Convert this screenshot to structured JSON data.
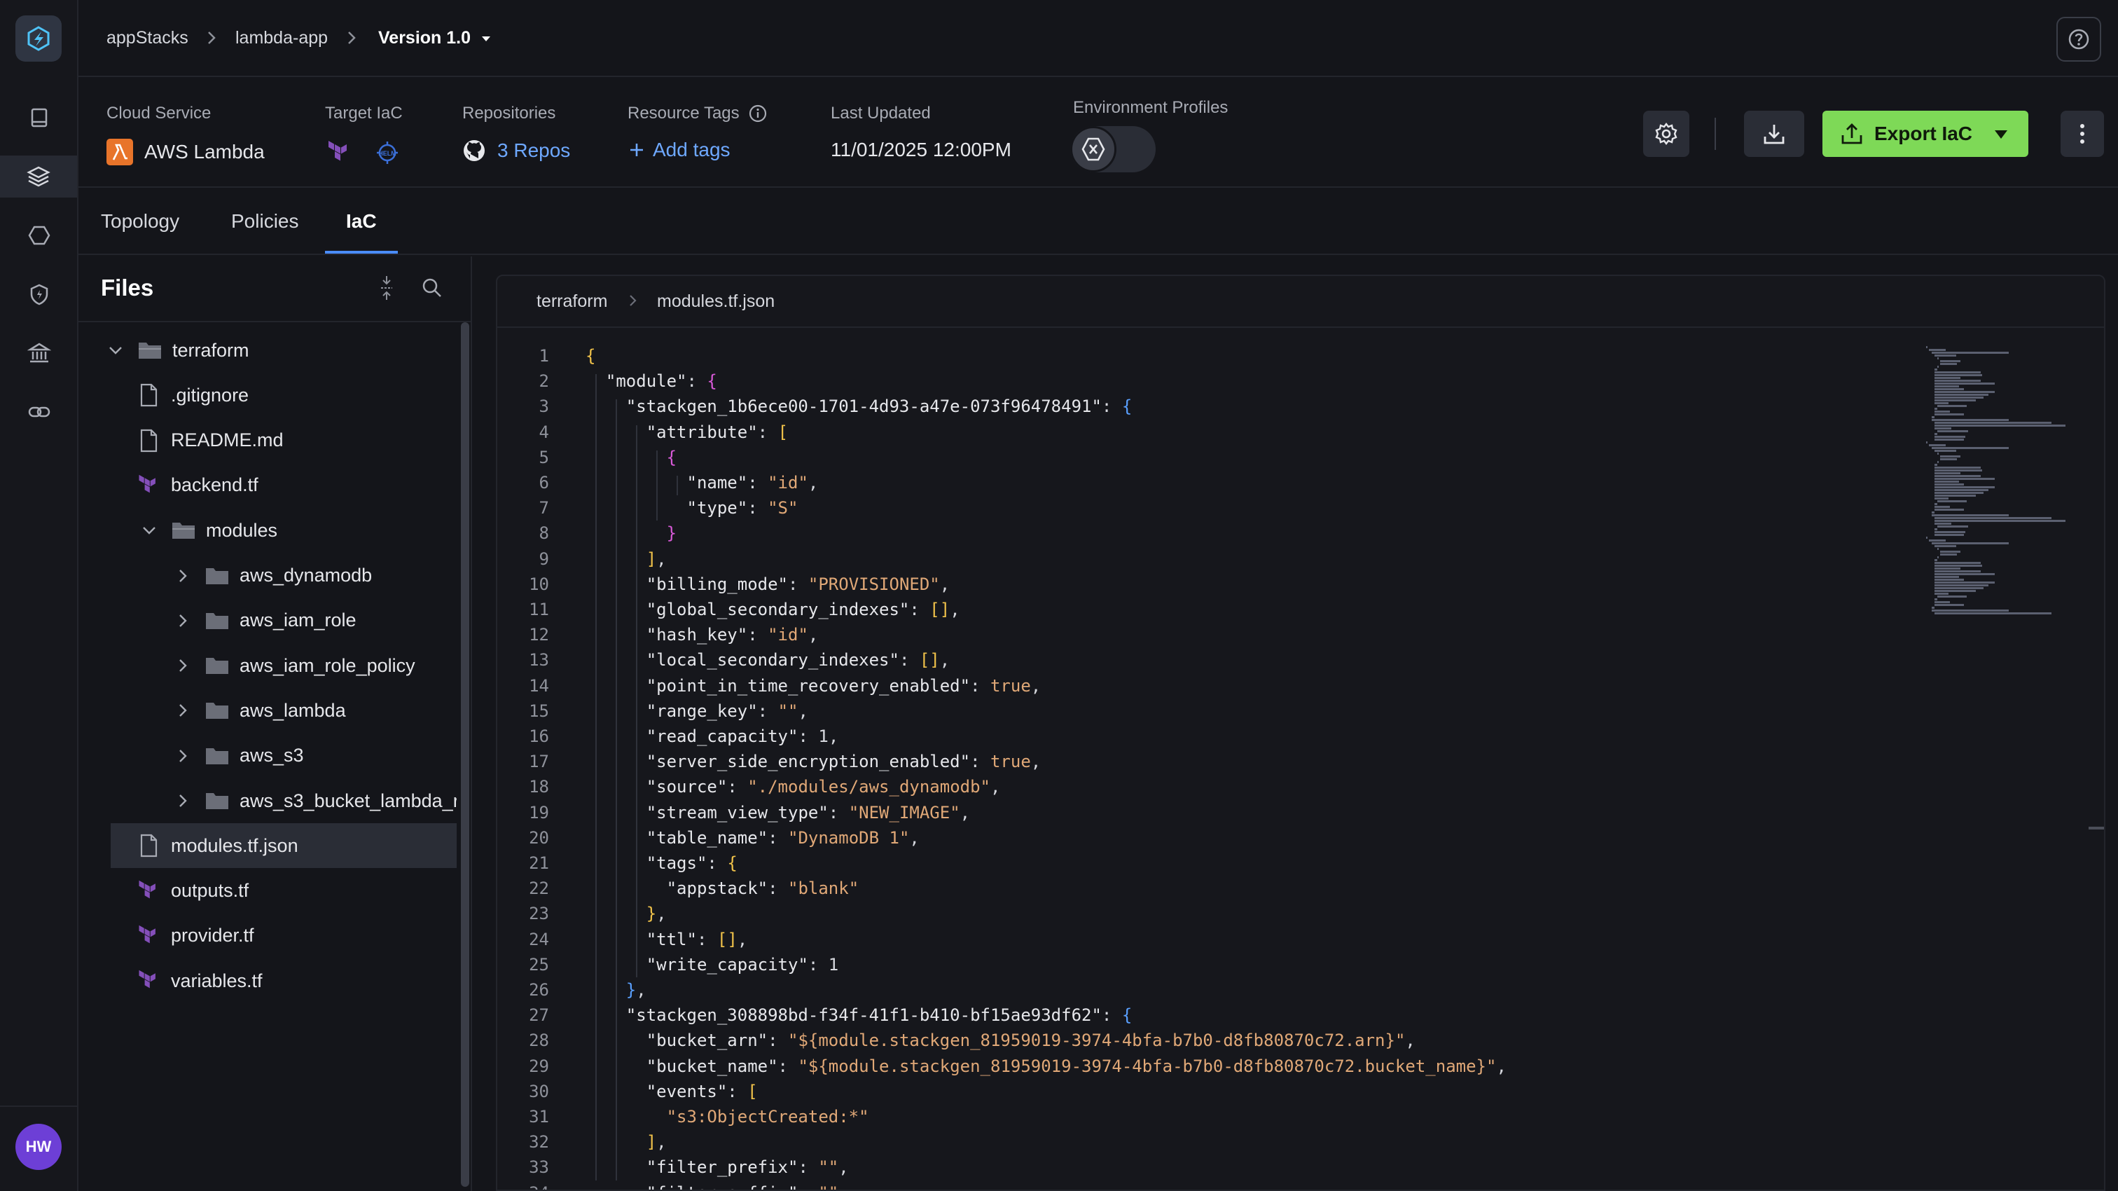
{
  "rail": {
    "avatar_initials": "HW"
  },
  "breadcrumb": {
    "items": [
      "appStacks",
      "lambda-app"
    ],
    "version": "Version 1.0"
  },
  "info": {
    "cloud_service_label": "Cloud Service",
    "cloud_service_value": "AWS Lambda",
    "target_iac_label": "Target IaC",
    "repositories_label": "Repositories",
    "repositories_value": "3 Repos",
    "resource_tags_label": "Resource Tags",
    "add_tags_label": "Add tags",
    "last_updated_label": "Last Updated",
    "last_updated_value": "11/01/2025 12:00PM",
    "env_profiles_label": "Environment Profiles",
    "export_label": "Export IaC"
  },
  "tabs": [
    "Topology",
    "Policies",
    "IaC"
  ],
  "files": {
    "title": "Files",
    "tree": [
      {
        "label": "terraform",
        "type": "folder-open",
        "depth": 0,
        "chev": "down"
      },
      {
        "label": ".gitignore",
        "type": "file",
        "depth": 1
      },
      {
        "label": "README.md",
        "type": "file",
        "depth": 1
      },
      {
        "label": "backend.tf",
        "type": "tf",
        "depth": 1
      },
      {
        "label": "modules",
        "type": "folder-open",
        "depth": 1,
        "chev": "down"
      },
      {
        "label": "aws_dynamodb",
        "type": "folder",
        "depth": 2,
        "chev": "right"
      },
      {
        "label": "aws_iam_role",
        "type": "folder",
        "depth": 2,
        "chev": "right"
      },
      {
        "label": "aws_iam_role_policy",
        "type": "folder",
        "depth": 2,
        "chev": "right"
      },
      {
        "label": "aws_lambda",
        "type": "folder",
        "depth": 2,
        "chev": "right"
      },
      {
        "label": "aws_s3",
        "type": "folder",
        "depth": 2,
        "chev": "right"
      },
      {
        "label": "aws_s3_bucket_lambda_r",
        "type": "folder",
        "depth": 2,
        "chev": "right"
      },
      {
        "label": "modules.tf.json",
        "type": "file",
        "depth": 1,
        "selected": true
      },
      {
        "label": "outputs.tf",
        "type": "tf",
        "depth": 1
      },
      {
        "label": "provider.tf",
        "type": "tf",
        "depth": 1
      },
      {
        "label": "variables.tf",
        "type": "tf",
        "depth": 1
      }
    ]
  },
  "editor": {
    "breadcrumb": [
      "terraform",
      "modules.tf.json"
    ],
    "lines": [
      "{",
      "  \"module\": {",
      "    \"stackgen_1b6ece00-1701-4d93-a47e-073f96478491\": {",
      "      \"attribute\": [",
      "        {",
      "          \"name\": \"id\",",
      "          \"type\": \"S\"",
      "        }",
      "      ],",
      "      \"billing_mode\": \"PROVISIONED\",",
      "      \"global_secondary_indexes\": [],",
      "      \"hash_key\": \"id\",",
      "      \"local_secondary_indexes\": [],",
      "      \"point_in_time_recovery_enabled\": true,",
      "      \"range_key\": \"\",",
      "      \"read_capacity\": 1,",
      "      \"server_side_encryption_enabled\": true,",
      "      \"source\": \"./modules/aws_dynamodb\",",
      "      \"stream_view_type\": \"NEW_IMAGE\",",
      "      \"table_name\": \"DynamoDB 1\",",
      "      \"tags\": {",
      "        \"appstack\": \"blank\"",
      "      },",
      "      \"ttl\": [],",
      "      \"write_capacity\": 1",
      "    },",
      "    \"stackgen_308898bd-f34f-41f1-b410-bf15ae93df62\": {",
      "      \"bucket_arn\": \"${module.stackgen_81959019-3974-4bfa-b7b0-d8fb80870c72.arn}\",",
      "      \"bucket_name\": \"${module.stackgen_81959019-3974-4bfa-b7b0-d8fb80870c72.bucket_name}\",",
      "      \"events\": [",
      "        \"s3:ObjectCreated:*\"",
      "      ],",
      "      \"filter_prefix\": \"\",",
      "      \"filter_suffix\": \"\""
    ]
  },
  "colors": {
    "accent": "#4a8cff",
    "export_button": "#7ed957",
    "terraform_purple": "#844fba"
  }
}
